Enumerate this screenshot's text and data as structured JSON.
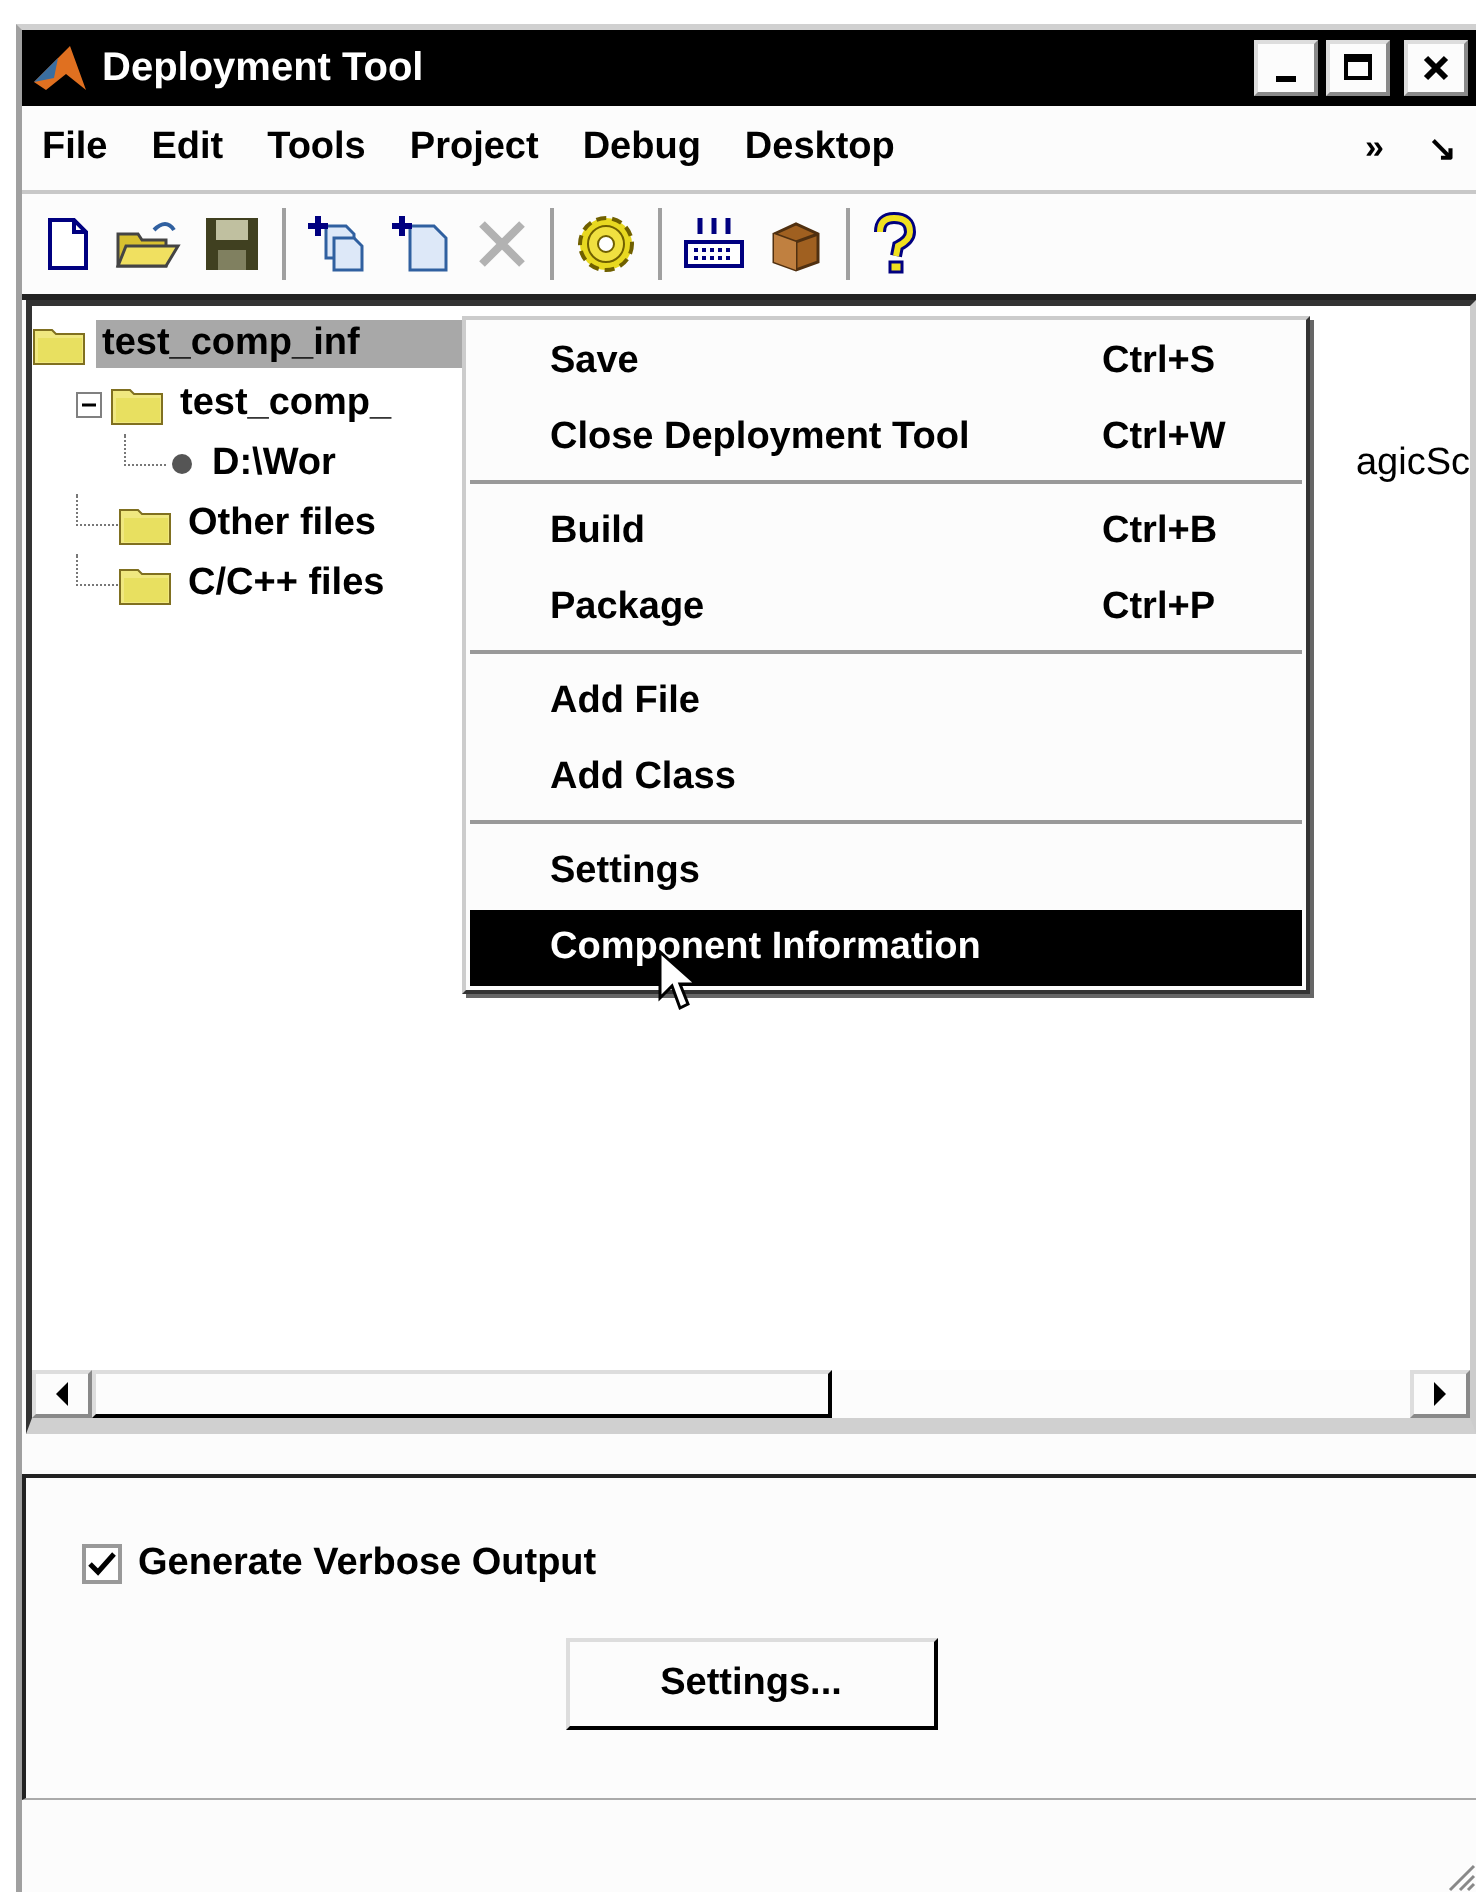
{
  "window": {
    "title": "Deployment Tool"
  },
  "menu_bar": {
    "items": [
      "File",
      "Edit",
      "Tools",
      "Project",
      "Debug",
      "Desktop"
    ],
    "overflow": "»",
    "undock": "↘"
  },
  "toolbar": [
    [
      {
        "kind": "new",
        "disabled": false
      },
      {
        "kind": "open",
        "disabled": false
      },
      {
        "kind": "save",
        "disabled": false
      }
    ],
    [
      {
        "kind": "add_files",
        "disabled": false
      },
      {
        "kind": "add_file",
        "disabled": false
      },
      {
        "kind": "remove",
        "disabled": true
      }
    ],
    [
      {
        "kind": "build",
        "disabled": false
      }
    ],
    [
      {
        "kind": "keys",
        "disabled": false
      },
      {
        "kind": "box",
        "disabled": false
      }
    ],
    [
      {
        "kind": "help",
        "disabled": false
      }
    ]
  ],
  "tree": [
    {
      "label": "test_comp_inf",
      "kind": "folder",
      "selected": true,
      "children": [
        {
          "label": "test_comp_",
          "kind": "folder",
          "selected": false,
          "expanded": true,
          "children": [
            {
              "label": "D:\\Wor",
              "kind": "file",
              "selected": false,
              "tail": "agicSc"
            }
          ]
        },
        {
          "label": "Other files",
          "kind": "folder",
          "selected": false
        },
        {
          "label": "C/C++ files",
          "kind": "folder",
          "selected": false
        }
      ]
    }
  ],
  "context_menu": [
    [
      {
        "label": "Save",
        "shortcut": "Ctrl+S",
        "selected": false
      },
      {
        "label": "Close Deployment Tool",
        "shortcut": "Ctrl+W",
        "selected": false
      }
    ],
    [
      {
        "label": "Build",
        "shortcut": "Ctrl+B",
        "selected": false
      },
      {
        "label": "Package",
        "shortcut": "Ctrl+P",
        "selected": false
      }
    ],
    [
      {
        "label": "Add File",
        "selected": false
      },
      {
        "label": "Add Class",
        "selected": false
      }
    ],
    [
      {
        "label": "Settings",
        "selected": false
      },
      {
        "label": "Component Information",
        "selected": true
      }
    ]
  ],
  "options": {
    "verbose": {
      "label": "Generate Verbose Output",
      "checked": true
    },
    "settings_button": "Settings..."
  }
}
